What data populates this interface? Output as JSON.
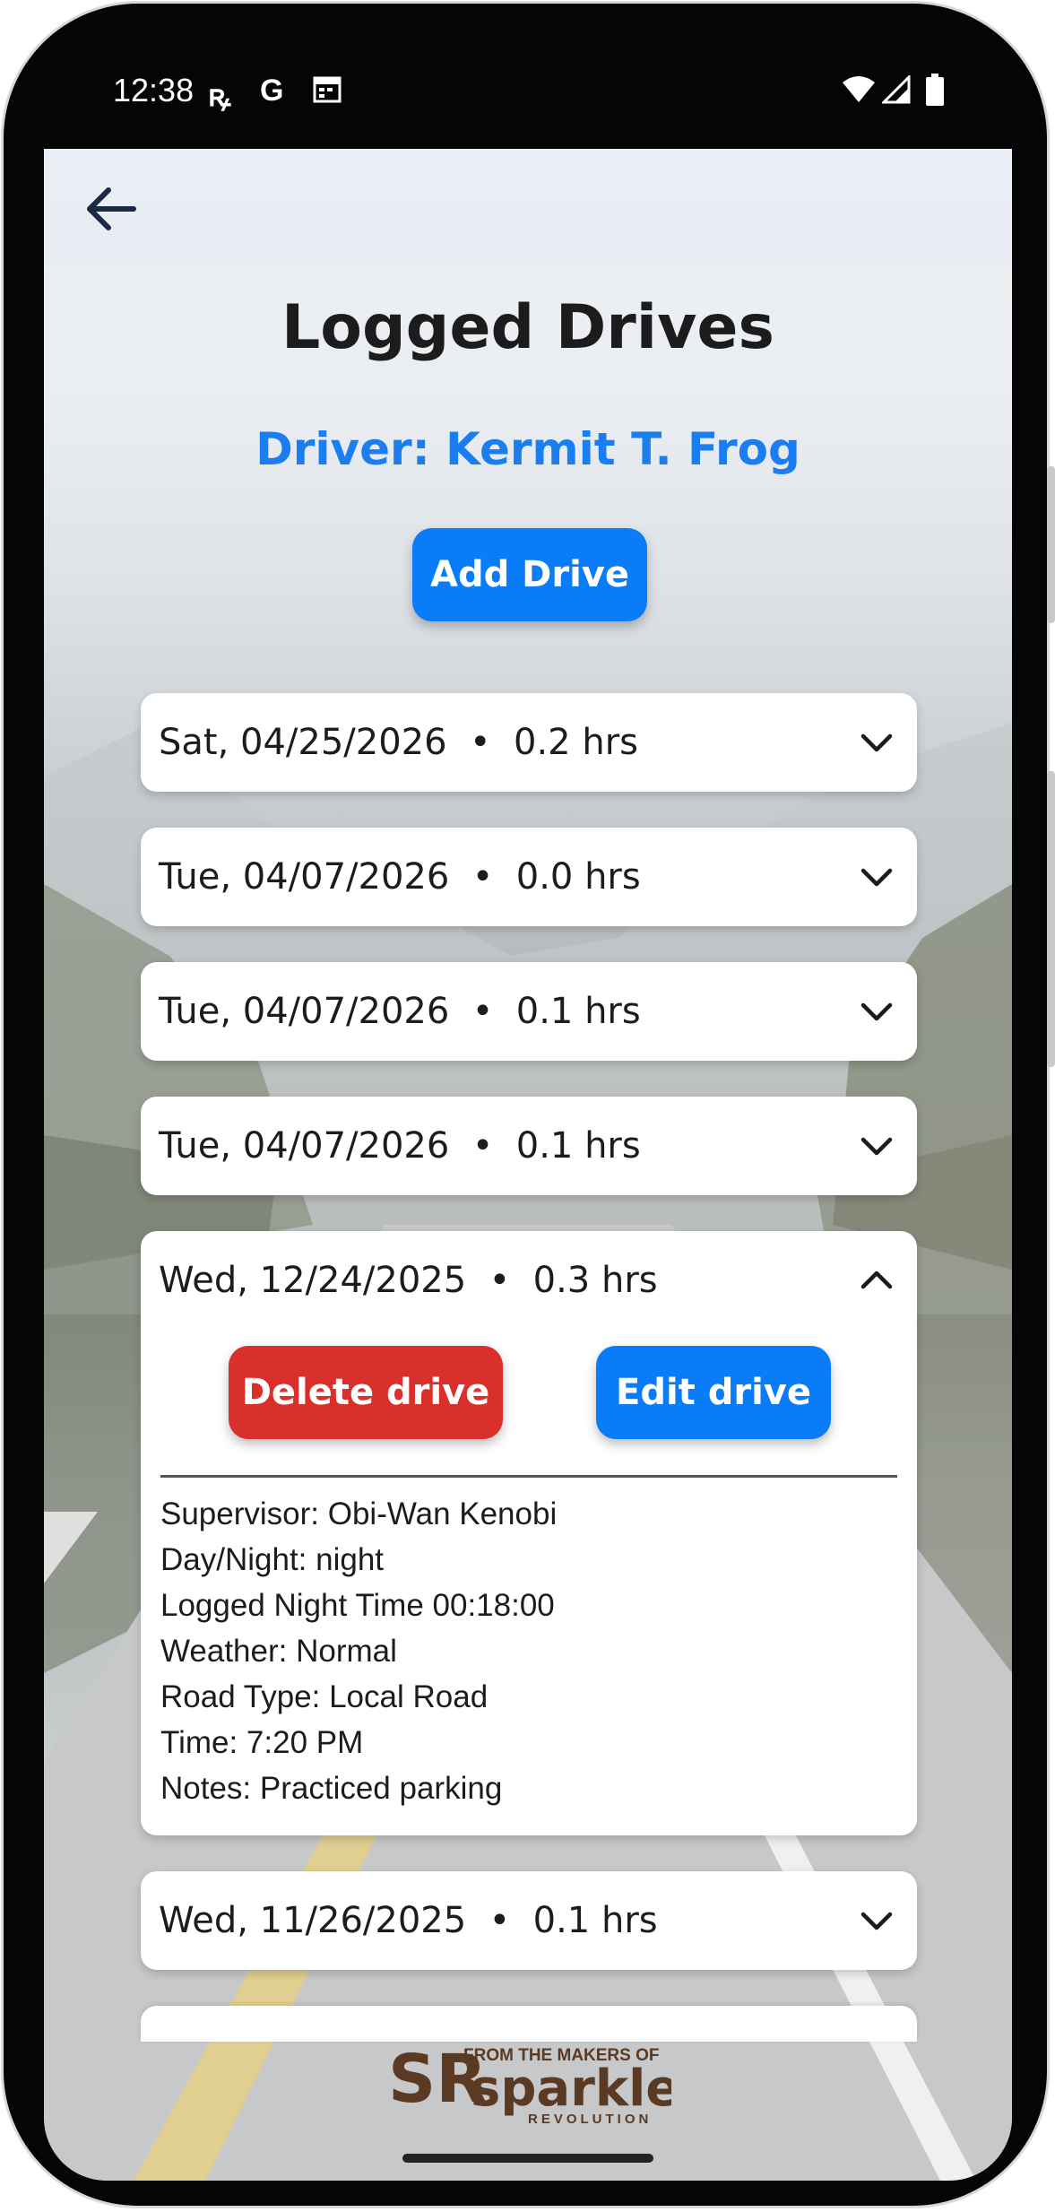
{
  "status_bar": {
    "time": "12:38",
    "left_icons": [
      "sr-icon",
      "google-icon",
      "calendar-icon"
    ],
    "right_icons": [
      "wifi-icon",
      "signal-icon",
      "battery-icon"
    ]
  },
  "colors": {
    "accent_blue": "#0a7cf8",
    "driver_blue": "#1a7ef0",
    "delete_red": "#d9302c"
  },
  "page": {
    "title": "Logged Drives",
    "driver_label": "Driver: Kermit T. Frog",
    "add_button": "Add Drive"
  },
  "drives": [
    {
      "summary": "Sat, 04/25/2026  •  0.2 hrs",
      "expanded": false
    },
    {
      "summary": "Tue, 04/07/2026  •  0.0 hrs",
      "expanded": false
    },
    {
      "summary": "Tue, 04/07/2026  •  0.1 hrs",
      "expanded": false
    },
    {
      "summary": "Tue, 04/07/2026  •  0.1 hrs",
      "expanded": false
    },
    {
      "summary": "Wed, 12/24/2025  •  0.3 hrs",
      "expanded": true,
      "delete_label": "Delete drive",
      "edit_label": "Edit drive",
      "details": [
        "Supervisor: Obi-Wan Kenobi",
        "Day/Night: night",
        "Logged Night Time 00:18:00",
        "Weather: Normal",
        "Road Type: Local Road",
        "Time: 7:20 PM",
        "Notes: Practiced parking"
      ]
    },
    {
      "summary": "Wed, 11/26/2025  •  0.1 hrs",
      "expanded": false
    }
  ],
  "footer": {
    "tagline": "FROM THE MAKERS OF",
    "brand": "sparkle",
    "brand_sub": "REVOLUTION",
    "monogram": "SR"
  }
}
